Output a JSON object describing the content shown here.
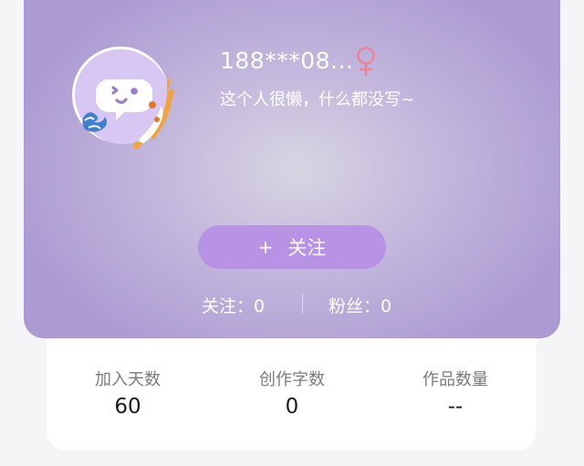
{
  "profile": {
    "username": "188***08...",
    "gender_icon": "female-symbol-icon",
    "bio": "这个人很懒，什么都没写~",
    "follow_button": {
      "icon": "plus-icon",
      "icon_text": "+",
      "label": "关注"
    },
    "following": {
      "label": "关注：",
      "value": "0"
    },
    "fans": {
      "label": "粉丝：",
      "value": "0"
    }
  },
  "stats": {
    "join_days": {
      "label": "加入天数",
      "value": "60"
    },
    "word_count": {
      "label": "创作字数",
      "value": "0"
    },
    "works_count": {
      "label": "作品数量",
      "value": "--"
    }
  },
  "colors": {
    "header_gradient_center": "#d9d5e2",
    "header_gradient_edge": "#ac9bd3",
    "follow_button": "#b892e4",
    "gender_icon": "#e8859a"
  }
}
